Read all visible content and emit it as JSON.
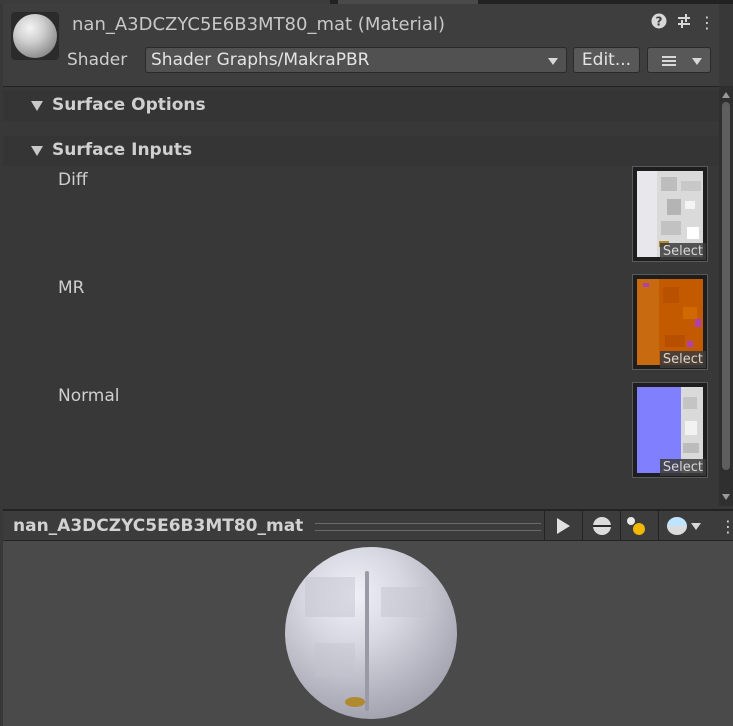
{
  "header": {
    "title": "nan_A3DCZYC5E6B3MT80_mat (Material)",
    "icons": [
      "help-icon",
      "settings-sliders-icon",
      "kebab-menu-icon"
    ],
    "help_glyph": "?",
    "kebab_glyph": "⋮",
    "shader_label": "Shader",
    "shader_value": "Shader Graphs/MakraPBR",
    "edit_label": "Edit..."
  },
  "sections": [
    {
      "label": "Surface Options",
      "expanded": true
    },
    {
      "label": "Surface Inputs",
      "expanded": true
    }
  ],
  "properties": [
    {
      "label": "Diff",
      "button": "Select",
      "swatch": "#dadada"
    },
    {
      "label": "MR",
      "button": "Select",
      "swatch": "#c45a00"
    },
    {
      "label": "Normal",
      "button": "Select",
      "swatch": "#8080ff"
    }
  ],
  "preview": {
    "title": "nan_A3DCZYC5E6B3MT80_mat",
    "kebab_glyph": "⋮",
    "icons": [
      "play-icon",
      "preview-sphere-icon",
      "lights-icon",
      "environment-sphere-icon",
      "kebab-menu-icon"
    ]
  },
  "colors": {
    "panel": "#383838",
    "header": "#3e3e3e",
    "preview_bg": "#4a4a4a"
  }
}
